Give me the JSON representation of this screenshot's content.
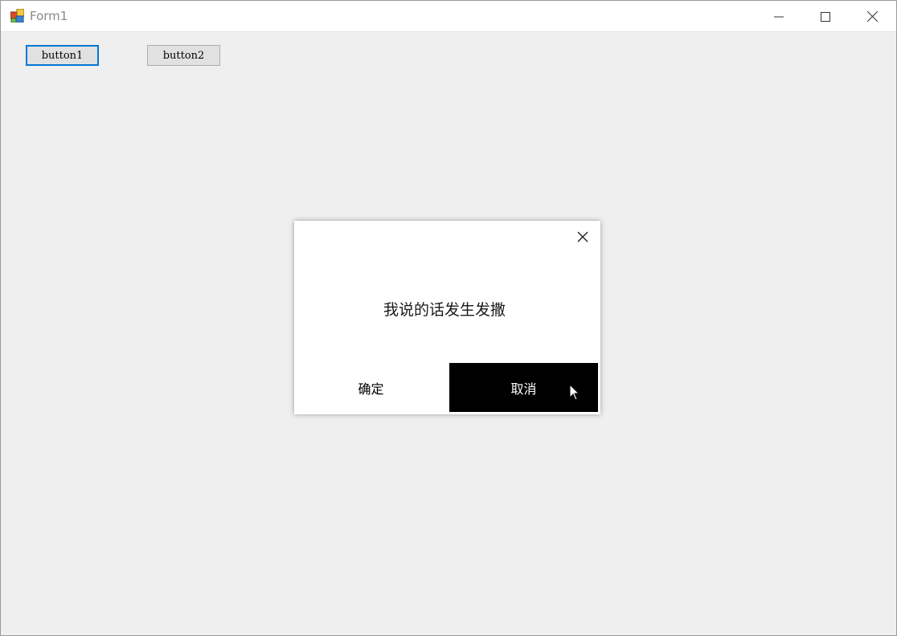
{
  "window": {
    "title": "Form1",
    "icon": "winforms-app-icon",
    "controls": [
      "minimize-icon",
      "maximize-icon",
      "close-icon"
    ]
  },
  "form": {
    "button1_label": "button1",
    "button2_label": "button2"
  },
  "dialog": {
    "message": "我说的话发生发撒",
    "ok_label": "确定",
    "cancel_label": "取消",
    "close_icon": "close-icon"
  },
  "colors": {
    "focus_border": "#0078d7",
    "form_background": "#efefef",
    "cancel_background": "#000000"
  },
  "cursor": "arrow-cursor-icon"
}
